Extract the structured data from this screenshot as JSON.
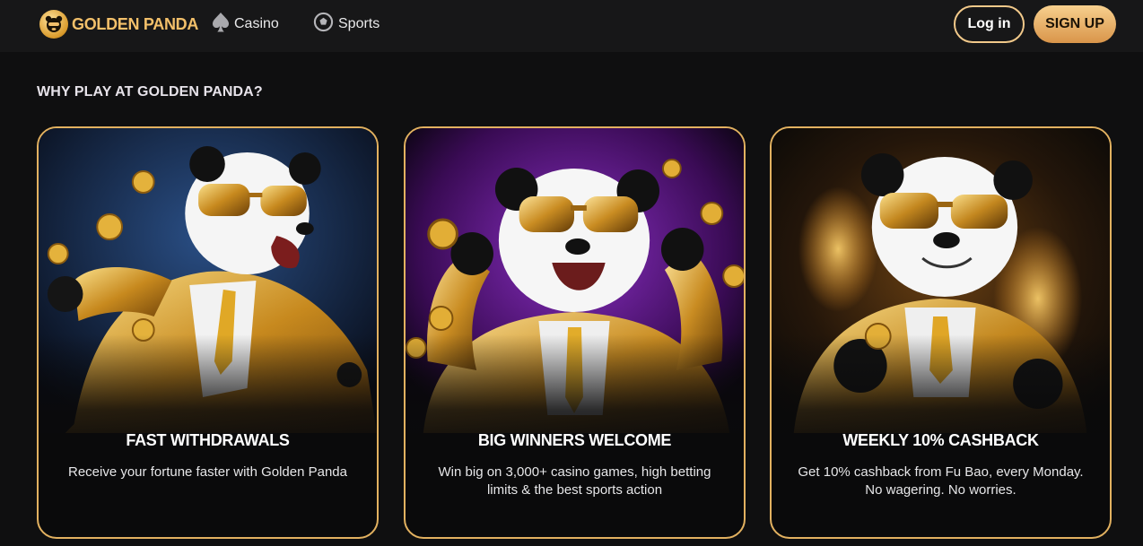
{
  "header": {
    "brand": "GOLDEN PANDA",
    "nav": [
      {
        "label": "Casino",
        "icon": "spade-icon"
      },
      {
        "label": "Sports",
        "icon": "soccer-ball-icon"
      }
    ],
    "login_label": "Log in",
    "signup_label": "SIGN UP"
  },
  "section": {
    "title": "WHY PLAY AT GOLDEN PANDA?",
    "cards": [
      {
        "title": "FAST WITHDRAWALS",
        "description": "Receive your fortune faster with Golden Panda",
        "image": "panda-running-with-coins",
        "background": "#13233f"
      },
      {
        "title": "BIG WINNERS WELCOME",
        "description": "Win big on 3,000+ casino games, high betting limits & the best sports action",
        "image": "panda-celebrating-purple",
        "background": "#4a0f6b"
      },
      {
        "title": "WEEKLY 10% CASHBACK",
        "description": "Get 10% cashback from Fu Bao, every Monday. No wagering. No worries.",
        "image": "panda-holding-coin-flames",
        "background": "#2a1a08"
      }
    ]
  },
  "colors": {
    "accent": "#e2b160",
    "background": "#0f0f10",
    "header": "#171718",
    "signup_gradient_top": "#f7d08e",
    "signup_gradient_bottom": "#d9954a"
  }
}
